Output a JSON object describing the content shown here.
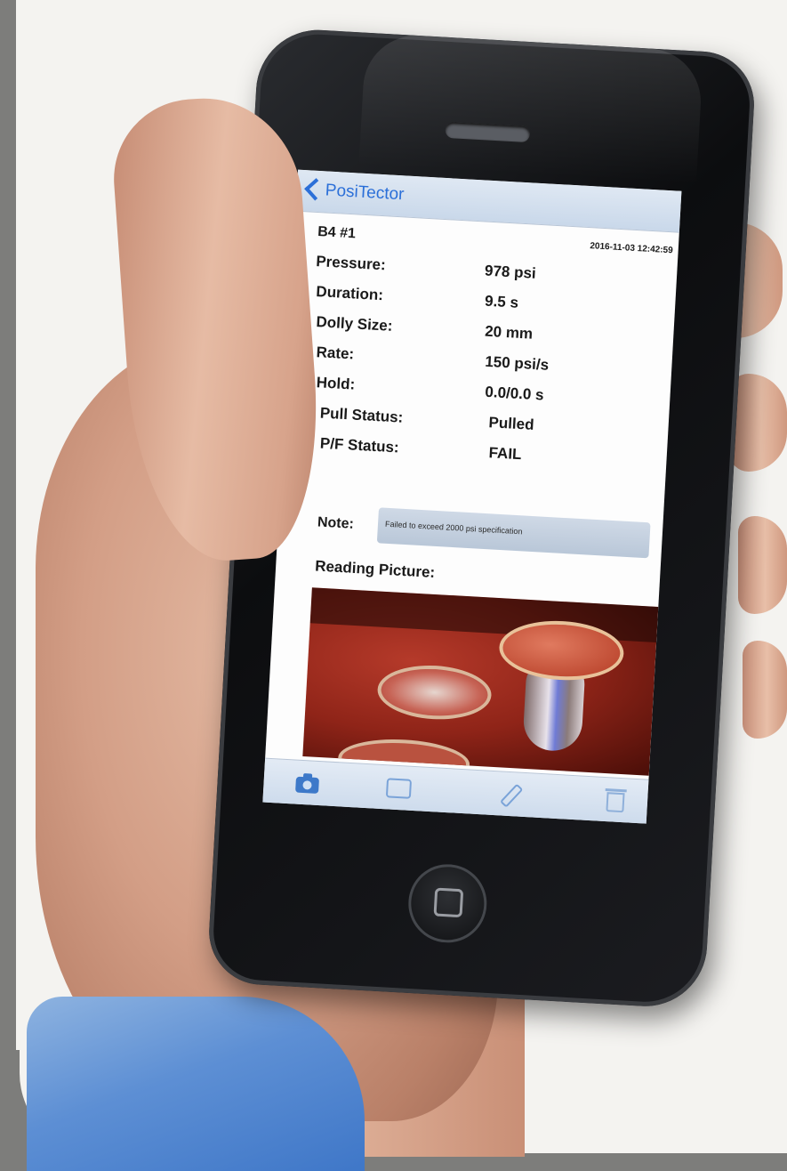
{
  "app": {
    "back_label": "PosiTector"
  },
  "reading": {
    "id": "B4 #1",
    "timestamp": "2016-11-03 12:42:59"
  },
  "rows": [
    {
      "label": "Pressure:",
      "value": "978 psi"
    },
    {
      "label": "Duration:",
      "value": "9.5 s"
    },
    {
      "label": "Dolly Size:",
      "value": "20 mm"
    },
    {
      "label": "Rate:",
      "value": "150 psi/s"
    },
    {
      "label": "Hold:",
      "value": "0.0/0.0 s"
    },
    {
      "label": "Pull Status:",
      "value": "Pulled"
    },
    {
      "label": "P/F Status:",
      "value": "FAIL"
    }
  ],
  "note": {
    "label": "Note:",
    "text": "Failed to exceed 2000 psi specification"
  },
  "picture": {
    "label": "Reading Picture:"
  },
  "toolbar": {
    "icons": [
      "camera-icon",
      "gallery-icon",
      "share-icon",
      "trash-icon"
    ]
  },
  "colors": {
    "accent": "#2b6fd8",
    "toolbar_icon": "#3d79c9"
  }
}
